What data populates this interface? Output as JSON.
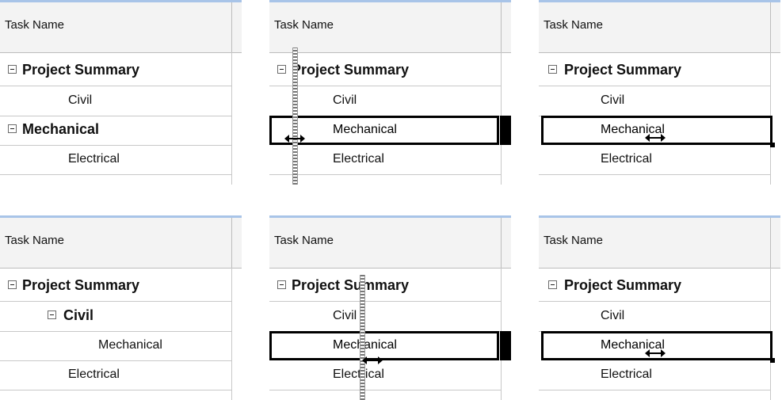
{
  "header_label": "Task Name",
  "tasks": {
    "project_summary": "Project Summary",
    "civil": "Civil",
    "mechanical": "Mechanical",
    "electrical": "Electrical"
  },
  "colors": {
    "header_bg": "#f3f3f3",
    "top_accent": "#a8c4e8",
    "grid_line": "#c8c8c8",
    "selection": "#000000"
  },
  "icons": [
    "collapse-box-icon",
    "resize-cursor-icon",
    "drag-indicator-icon"
  ]
}
